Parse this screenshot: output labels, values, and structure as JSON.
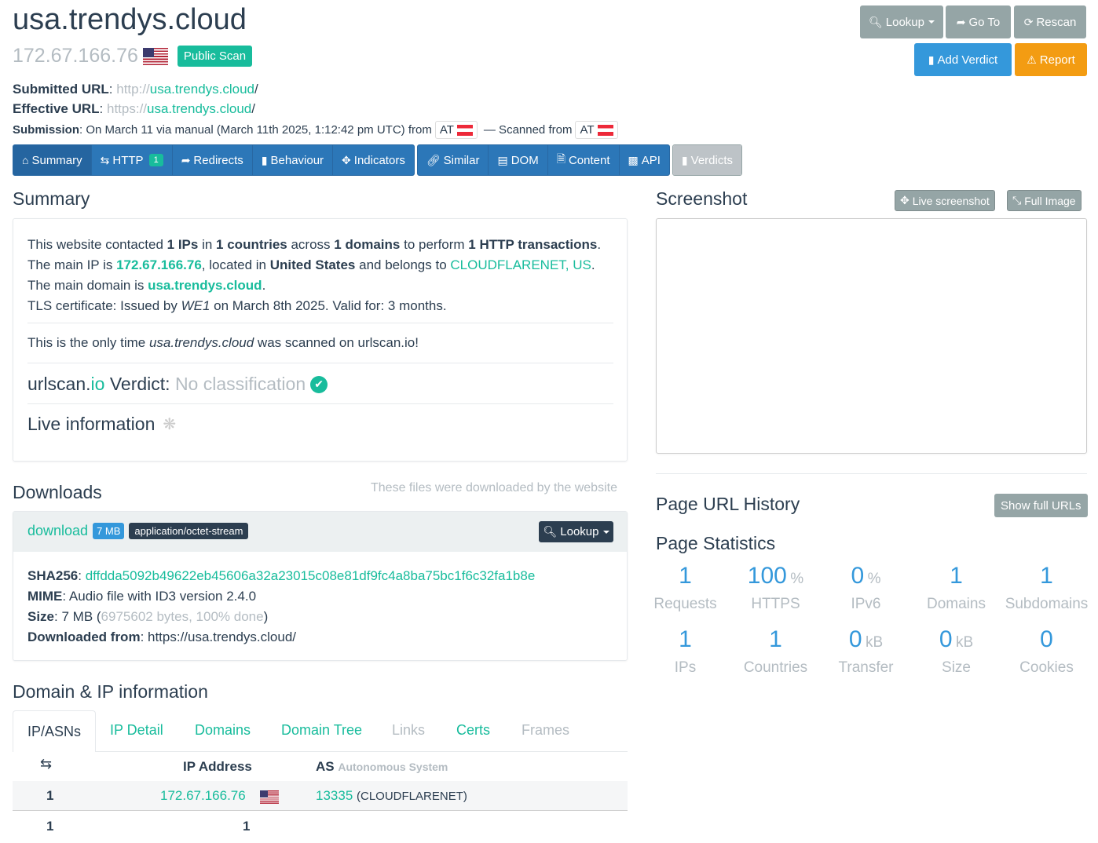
{
  "header": {
    "domain": "usa.trendys.cloud",
    "ip": "172.67.166.76",
    "scan_badge": "Public Scan",
    "submitted_label": "Submitted URL",
    "submitted_scheme": "http://",
    "submitted_host": "usa.trendys.cloud",
    "submitted_path": "/",
    "effective_label": "Effective URL",
    "effective_scheme": "https://",
    "effective_host": "usa.trendys.cloud",
    "effective_path": "/",
    "submission_label": "Submission",
    "submission_text": ": On March 11 via manual (March 11th 2025, 1:12:42 pm UTC) from",
    "from_country": "AT",
    "scanned_from_text": "— Scanned from",
    "scanned_country": "AT"
  },
  "top_buttons": {
    "lookup": "Lookup",
    "goto": "Go To",
    "rescan": "Rescan",
    "add_verdict": "Add Verdict",
    "report": "Report"
  },
  "nav": {
    "summary": "Summary",
    "http": "HTTP",
    "http_count": "1",
    "redirects": "Redirects",
    "behaviour": "Behaviour",
    "indicators": "Indicators",
    "similar": "Similar",
    "dom": "DOM",
    "content": "Content",
    "api": "API",
    "verdicts": "Verdicts"
  },
  "summary": {
    "title": "Summary",
    "l1_a": "This website contacted ",
    "ips": "1 IPs",
    "l1_b": " in ",
    "countries": "1 countries",
    "l1_c": " across ",
    "domains": "1 domains",
    "l1_d": " to perform ",
    "transactions": "1 HTTP transactions",
    "l1_e": ".",
    "l2_a": "The main IP is ",
    "main_ip": "172.67.166.76",
    "l2_b": ", located in ",
    "country": "United States",
    "l2_c": " and belongs to ",
    "asn": "CLOUDFLARENET, US",
    "l2_d": ".",
    "l3_a": "The main domain is ",
    "main_domain": "usa.trendys.cloud",
    "l3_b": ".",
    "l4_a": "TLS certificate: Issued by ",
    "issuer": "WE1",
    "l4_b": " on March 8th 2025. Valid for: 3 months.",
    "only_a": "This is the only time ",
    "only_domain": "usa.trendys.cloud",
    "only_b": " was scanned on urlscan.io!",
    "verdict_a": "urlscan.",
    "verdict_io": "io",
    "verdict_b": " Verdict: ",
    "verdict_value": "No classification",
    "live_info": "Live information"
  },
  "screenshot": {
    "title": "Screenshot",
    "live_btn": "Live screenshot",
    "full_btn": "Full Image"
  },
  "downloads": {
    "title": "Downloads",
    "note": "These files were downloaded by the website",
    "file_link": "download",
    "size_badge": "7 MB",
    "mime_badge": "application/octet-stream",
    "lookup_btn": "Lookup",
    "sha_label": "SHA256",
    "sha": "dffdda5092b49622eb45606a32a23015c08e81df9fc4a8ba75bc1f6c32fa1b8e",
    "mime_label": "MIME",
    "mime": ": Audio file with ID3 version 2.4.0",
    "size_label": "Size",
    "size_a": ": 7 MB (",
    "size_bytes": "6975602 bytes, 100% done",
    "size_b": ")",
    "from_label": "Downloaded from",
    "from": ": https://usa.trendys.cloud/"
  },
  "history": {
    "title": "Page URL History",
    "show_btn": "Show full URLs"
  },
  "stats": {
    "title": "Page Statistics",
    "items": [
      {
        "value": "1",
        "unit": "",
        "label": "Requests"
      },
      {
        "value": "100",
        "unit": "%",
        "label": "HTTPS"
      },
      {
        "value": "0",
        "unit": "%",
        "label": "IPv6"
      },
      {
        "value": "1",
        "unit": "",
        "label": "Domains"
      },
      {
        "value": "1",
        "unit": "",
        "label": "Subdomains"
      },
      {
        "value": "1",
        "unit": "",
        "label": "IPs"
      },
      {
        "value": "1",
        "unit": "",
        "label": "Countries"
      },
      {
        "value": "0",
        "unit": "kB",
        "label": "Transfer"
      },
      {
        "value": "0",
        "unit": "kB",
        "label": "Size"
      },
      {
        "value": "0",
        "unit": "",
        "label": "Cookies"
      }
    ]
  },
  "domain_ip": {
    "title": "Domain & IP information",
    "tabs": [
      "IP/ASNs",
      "IP Detail",
      "Domains",
      "Domain Tree",
      "Links",
      "Certs",
      "Frames"
    ],
    "col_ip": "IP Address",
    "col_as": "AS",
    "col_as_sub": "Autonomous System",
    "row_count": "1",
    "row_ip": "172.67.166.76",
    "row_asn": "13335",
    "row_asn_name": "(CLOUDFLARENET)",
    "total_count": "1",
    "total_ips": "1"
  }
}
